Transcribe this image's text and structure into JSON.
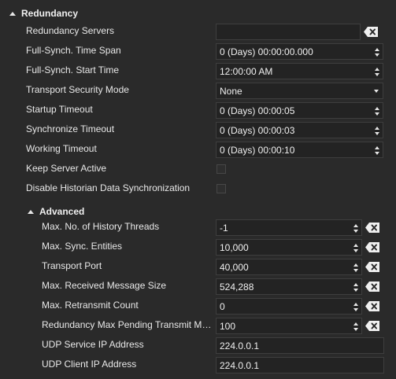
{
  "redundancy": {
    "title": "Redundancy",
    "servers_label": "Redundancy Servers",
    "servers_value": "",
    "full_synch_span_label": "Full-Synch. Time Span",
    "full_synch_span_value": "0 (Days) 00:00:00.000",
    "full_synch_start_label": "Full-Synch. Start Time",
    "full_synch_start_value": "12:00:00 AM",
    "security_mode_label": "Transport Security Mode",
    "security_mode_value": "None",
    "startup_timeout_label": "Startup Timeout",
    "startup_timeout_value": "0 (Days) 00:00:05",
    "sync_timeout_label": "Synchronize Timeout",
    "sync_timeout_value": "0 (Days) 00:00:03",
    "working_timeout_label": "Working Timeout",
    "working_timeout_value": "0 (Days) 00:00:10",
    "keep_active_label": "Keep Server Active",
    "keep_active_checked": false,
    "disable_hist_label": "Disable Historian Data Synchronization",
    "disable_hist_checked": false
  },
  "advanced": {
    "title": "Advanced",
    "max_history_threads_label": "Max. No. of History Threads",
    "max_history_threads_value": "-1",
    "max_sync_entities_label": "Max. Sync. Entities",
    "max_sync_entities_value": "10,000",
    "transport_port_label": "Transport Port",
    "transport_port_value": "40,000",
    "max_msg_size_label": "Max. Received Message Size",
    "max_msg_size_value": "524,288",
    "max_retransmit_label": "Max. Retransmit Count",
    "max_retransmit_value": "0",
    "max_pending_label": "Redundancy Max Pending Transmit Mes...",
    "max_pending_value": "100",
    "udp_service_label": "UDP Service IP Address",
    "udp_service_value": "224.0.0.1",
    "udp_client_label": "UDP Client IP Address",
    "udp_client_value": "224.0.0.1"
  },
  "icons": {
    "collapse": "collapse-triangle-icon",
    "clear": "clear-backspace-icon",
    "spin": "spin-up-down-icon",
    "dropdown": "dropdown-arrow-icon"
  }
}
